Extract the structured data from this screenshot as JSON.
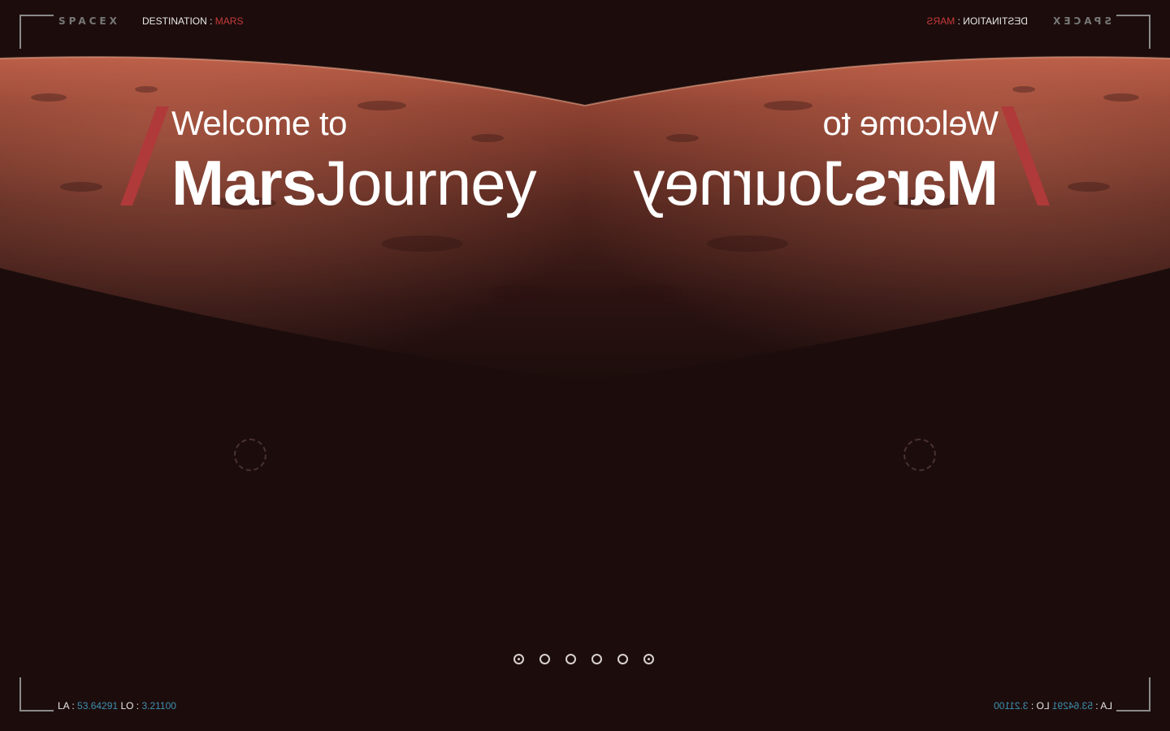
{
  "header": {
    "logo_text": "SPACEX",
    "destination_label": "DESTINATION :",
    "destination_value": "MARS"
  },
  "hero": {
    "welcome": "Welcome to",
    "brand_bold": "Mars",
    "brand_light": "Journey"
  },
  "footer": {
    "la_label": "LA :",
    "la_value": "53.64291",
    "lo_label": "LO :",
    "lo_value": "3.21100"
  },
  "pagination": {
    "count": 6,
    "active_indices": [
      0,
      5
    ]
  },
  "colors": {
    "background": "#1a0c0b",
    "accent_red": "#c63a3a",
    "coord_blue": "#3f8fb0",
    "slash_red": "#b0393a"
  },
  "icons": {
    "loader": "dashed-ring-icon"
  }
}
